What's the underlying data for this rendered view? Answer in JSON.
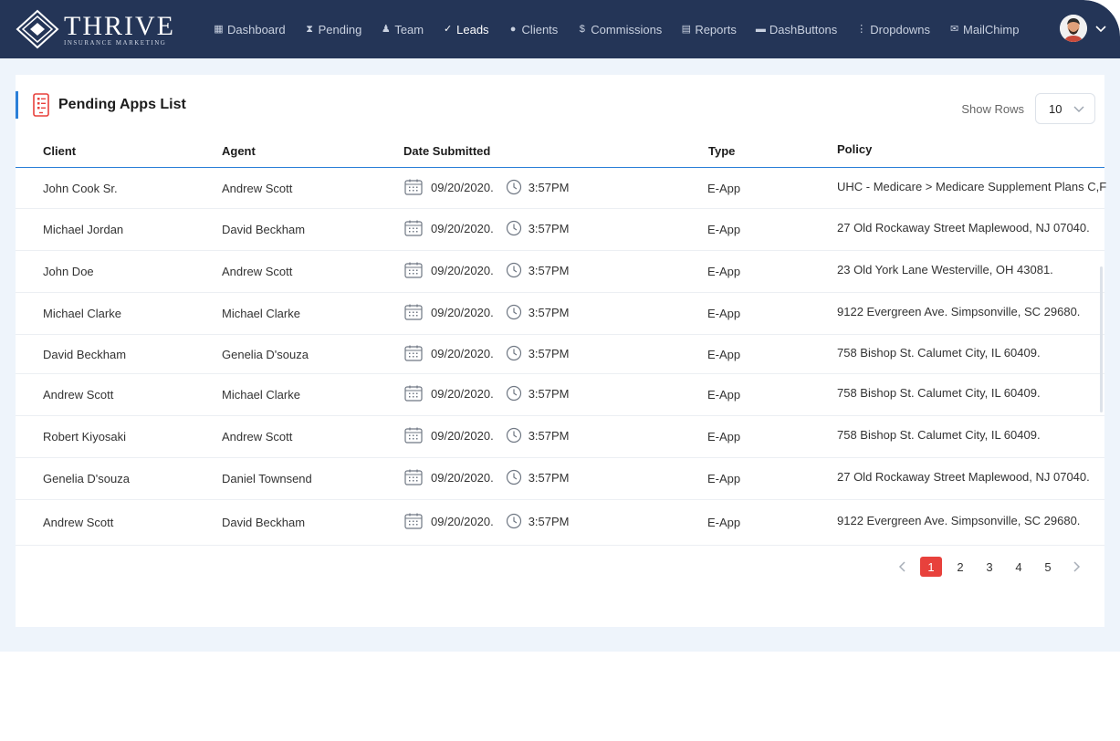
{
  "brand": {
    "name": "THRIVE",
    "tagline": "INSURANCE MARKETING"
  },
  "nav": [
    {
      "label": "Dashboard",
      "icon": "dashboard-icon",
      "glyph": "▦"
    },
    {
      "label": "Pending",
      "icon": "hourglass-icon",
      "glyph": "⧗"
    },
    {
      "label": "Team",
      "icon": "team-icon",
      "glyph": "♟"
    },
    {
      "label": "Leads",
      "icon": "leads-icon",
      "glyph": "✓"
    },
    {
      "label": "Clients",
      "icon": "user-icon",
      "glyph": "●"
    },
    {
      "label": "Commissions",
      "icon": "dollar-icon",
      "glyph": "$"
    },
    {
      "label": "Reports",
      "icon": "report-icon",
      "glyph": "▤"
    },
    {
      "label": "DashButtons",
      "icon": "briefcase-icon",
      "glyph": "▬"
    },
    {
      "label": "Dropdowns",
      "icon": "dropdown-icon",
      "glyph": "⋮"
    },
    {
      "label": "MailChimp",
      "icon": "mail-icon",
      "glyph": "✉"
    }
  ],
  "active_nav": "Leads",
  "card": {
    "title": "Pending Apps List",
    "show_rows_label": "Show Rows",
    "rows_value": "10"
  },
  "columns": {
    "client": "Client",
    "agent": "Agent",
    "date": "Date Submitted",
    "type": "Type",
    "policy": "Policy"
  },
  "rows": [
    {
      "client": "John Cook Sr.",
      "agent": "Andrew Scott",
      "date": "09/20/2020.",
      "time": "3:57PM",
      "type": "E-App",
      "policy": "UHC - Medicare > Medicare Supplement Plans C,F"
    },
    {
      "client": "Michael Jordan",
      "agent": "David Beckham",
      "date": "09/20/2020.",
      "time": "3:57PM",
      "type": "E-App",
      "policy": "27 Old Rockaway Street Maplewood, NJ 07040."
    },
    {
      "client": "John Doe",
      "agent": "Andrew Scott",
      "date": "09/20/2020.",
      "time": "3:57PM",
      "type": "E-App",
      "policy": "23 Old York Lane Westerville, OH 43081."
    },
    {
      "client": "Michael Clarke",
      "agent": "Michael Clarke",
      "date": "09/20/2020.",
      "time": "3:57PM",
      "type": "E-App",
      "policy": "9122 Evergreen Ave. Simpsonville, SC 29680."
    },
    {
      "client": "David Beckham",
      "agent": "Genelia D'souza",
      "date": "09/20/2020.",
      "time": "3:57PM",
      "type": "E-App",
      "policy": "758 Bishop St. Calumet City, IL 60409."
    },
    {
      "client": "Andrew Scott",
      "agent": "Michael Clarke",
      "date": "09/20/2020.",
      "time": "3:57PM",
      "type": "E-App",
      "policy": "758 Bishop St. Calumet City, IL 60409."
    },
    {
      "client": "Robert Kiyosaki",
      "agent": "Andrew Scott",
      "date": "09/20/2020.",
      "time": "3:57PM",
      "type": "E-App",
      "policy": "758 Bishop St. Calumet City, IL 60409."
    },
    {
      "client": "Genelia D'souza",
      "agent": "Daniel Townsend",
      "date": "09/20/2020.",
      "time": "3:57PM",
      "type": "E-App",
      "policy": "27 Old Rockaway Street Maplewood, NJ 07040."
    },
    {
      "client": "Andrew Scott",
      "agent": "David Beckham",
      "date": "09/20/2020.",
      "time": "3:57PM",
      "type": "E-App",
      "policy": "9122 Evergreen Ave. Simpsonville, SC 29680."
    }
  ],
  "pagination": {
    "pages": [
      "1",
      "2",
      "3",
      "4",
      "5"
    ],
    "current": "1"
  },
  "colors": {
    "navbar": "#243557",
    "accent": "#2b7fd8",
    "active_page": "#e8413c",
    "background": "#eef4fb"
  }
}
